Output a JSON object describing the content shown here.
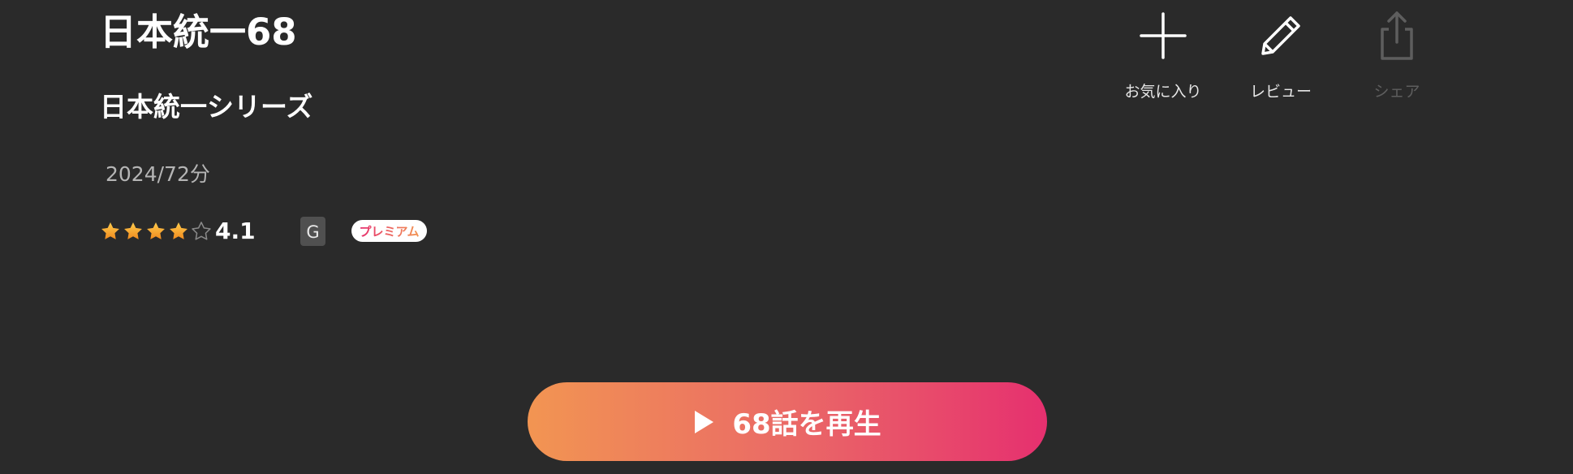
{
  "header": {
    "title": "日本統一68",
    "series": "日本統一シリーズ",
    "meta": "2024/72分"
  },
  "rating": {
    "stars_filled": 4,
    "stars_total": 5,
    "value": "4.1"
  },
  "badges": {
    "age_rating": "G",
    "premium": "プレミアム"
  },
  "actions": {
    "favorite": {
      "label": "お気に入り",
      "icon": "plus-icon"
    },
    "review": {
      "label": "レビュー",
      "icon": "pencil-icon"
    },
    "share": {
      "label": "シェア",
      "icon": "share-icon",
      "disabled": true
    }
  },
  "play": {
    "label": "68話を再生",
    "icon": "play-icon"
  },
  "colors": {
    "background": "#2a2a2a",
    "accent_start": "#f29552",
    "accent_end": "#e6306f",
    "star": "#f6a623",
    "muted_text": "#b5b5b5",
    "disabled": "#5e5e5e"
  }
}
